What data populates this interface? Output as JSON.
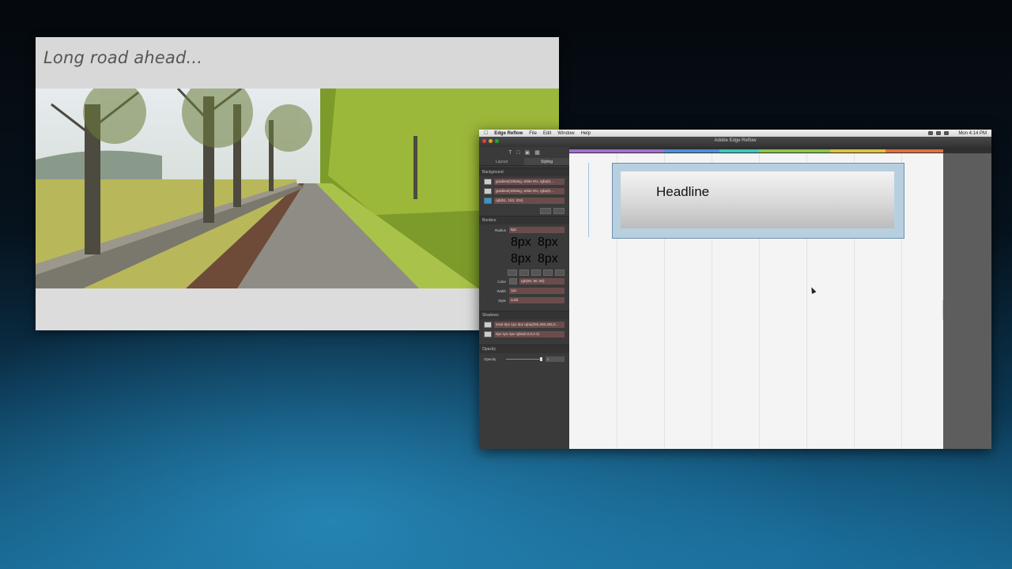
{
  "preview": {
    "title": "Long road ahead..."
  },
  "app": {
    "menubar": {
      "apple": "",
      "app_name": "Edge Reflow",
      "items": [
        "File",
        "Edit",
        "Window",
        "Help"
      ],
      "clock": "Mon 4:14 PM"
    },
    "window_title": "Adobe Edge Reflow",
    "panel": {
      "tabs": [
        "Layout",
        "Styling"
      ],
      "sections": {
        "background": "Background",
        "borders": "Borders",
        "shadows": "Shadows",
        "opacity": "Opacity"
      },
      "background_layers": [
        "gradient(180deg, white 0%, rgba(0,...",
        "gradient(180deg, white 0%, rgba(0,...",
        "rgb(51, 153, 204)"
      ],
      "radius_label": "Radius",
      "radius_value": "8px",
      "radius_corners": [
        "8px",
        "8px",
        "8px",
        "8px"
      ],
      "color_label": "Color",
      "color_value": "rgb(90, 90, 90)",
      "width_label": "Width",
      "width_value": "1px",
      "style_label": "Style",
      "style_value": "solid",
      "shadows": [
        "inset 0px 1px 0px rgba(255,255,255,0...",
        "0px 1px 2px rgba(0,0,0,0.3)"
      ],
      "opacity_label": "Opacity",
      "opacity_value": "1"
    },
    "canvas": {
      "headline": "Headline"
    },
    "colors": {
      "breakpoints": [
        "#a070d0",
        "#4a90d9",
        "#3cc6c0",
        "#8ac64a",
        "#e0c040",
        "#e07040"
      ]
    }
  }
}
